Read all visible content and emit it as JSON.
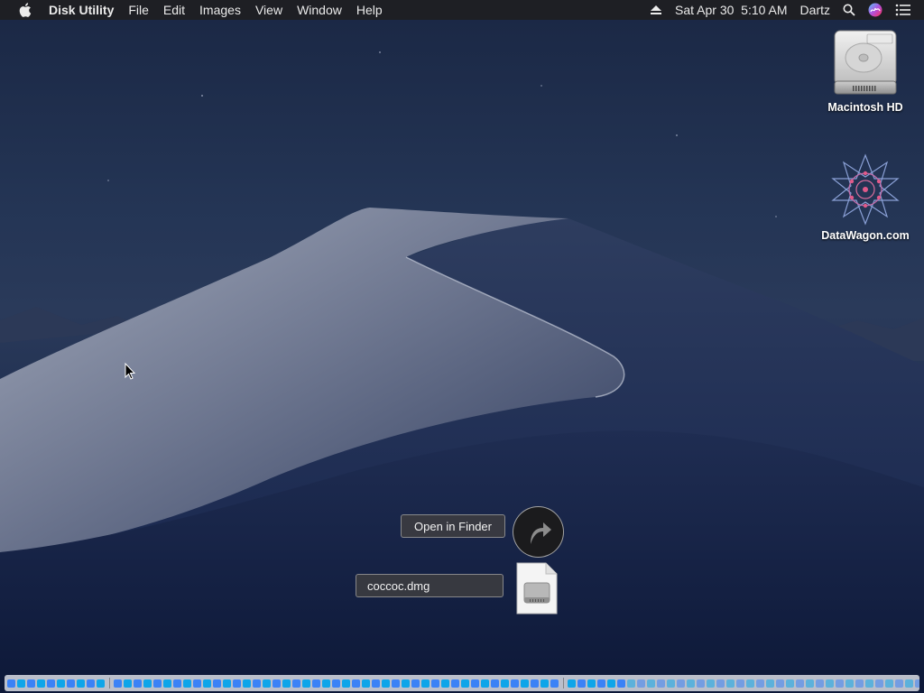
{
  "menubar": {
    "apple_icon": "apple-logo-icon",
    "app_name": "Disk Utility",
    "menus": [
      "File",
      "Edit",
      "Images",
      "View",
      "Window",
      "Help"
    ],
    "eject_icon": "eject-icon",
    "datetime": "Sat Apr 30  5:10 AM",
    "user": "Dartz",
    "search_icon": "spotlight-search-icon",
    "siri_icon": "siri-icon",
    "notifications_icon": "notification-center-icon"
  },
  "desktop_icons": [
    {
      "label": "Macintosh HD",
      "icon": "hard-drive-icon"
    },
    {
      "label": "DataWagon.com",
      "icon": "datawagon-logo-icon"
    }
  ],
  "download": {
    "open_in_finder": "Open in Finder",
    "filename": "coccoc.dmg",
    "reveal_icon": "curved-arrow-icon",
    "file_icon": "disk-image-file-icon"
  },
  "colors": {
    "menubar_bg": "#1e1e22",
    "wallpaper_sky": "#1a2744",
    "dune_light": "#8a93a8",
    "dune_dark": "#1b2a4c"
  }
}
